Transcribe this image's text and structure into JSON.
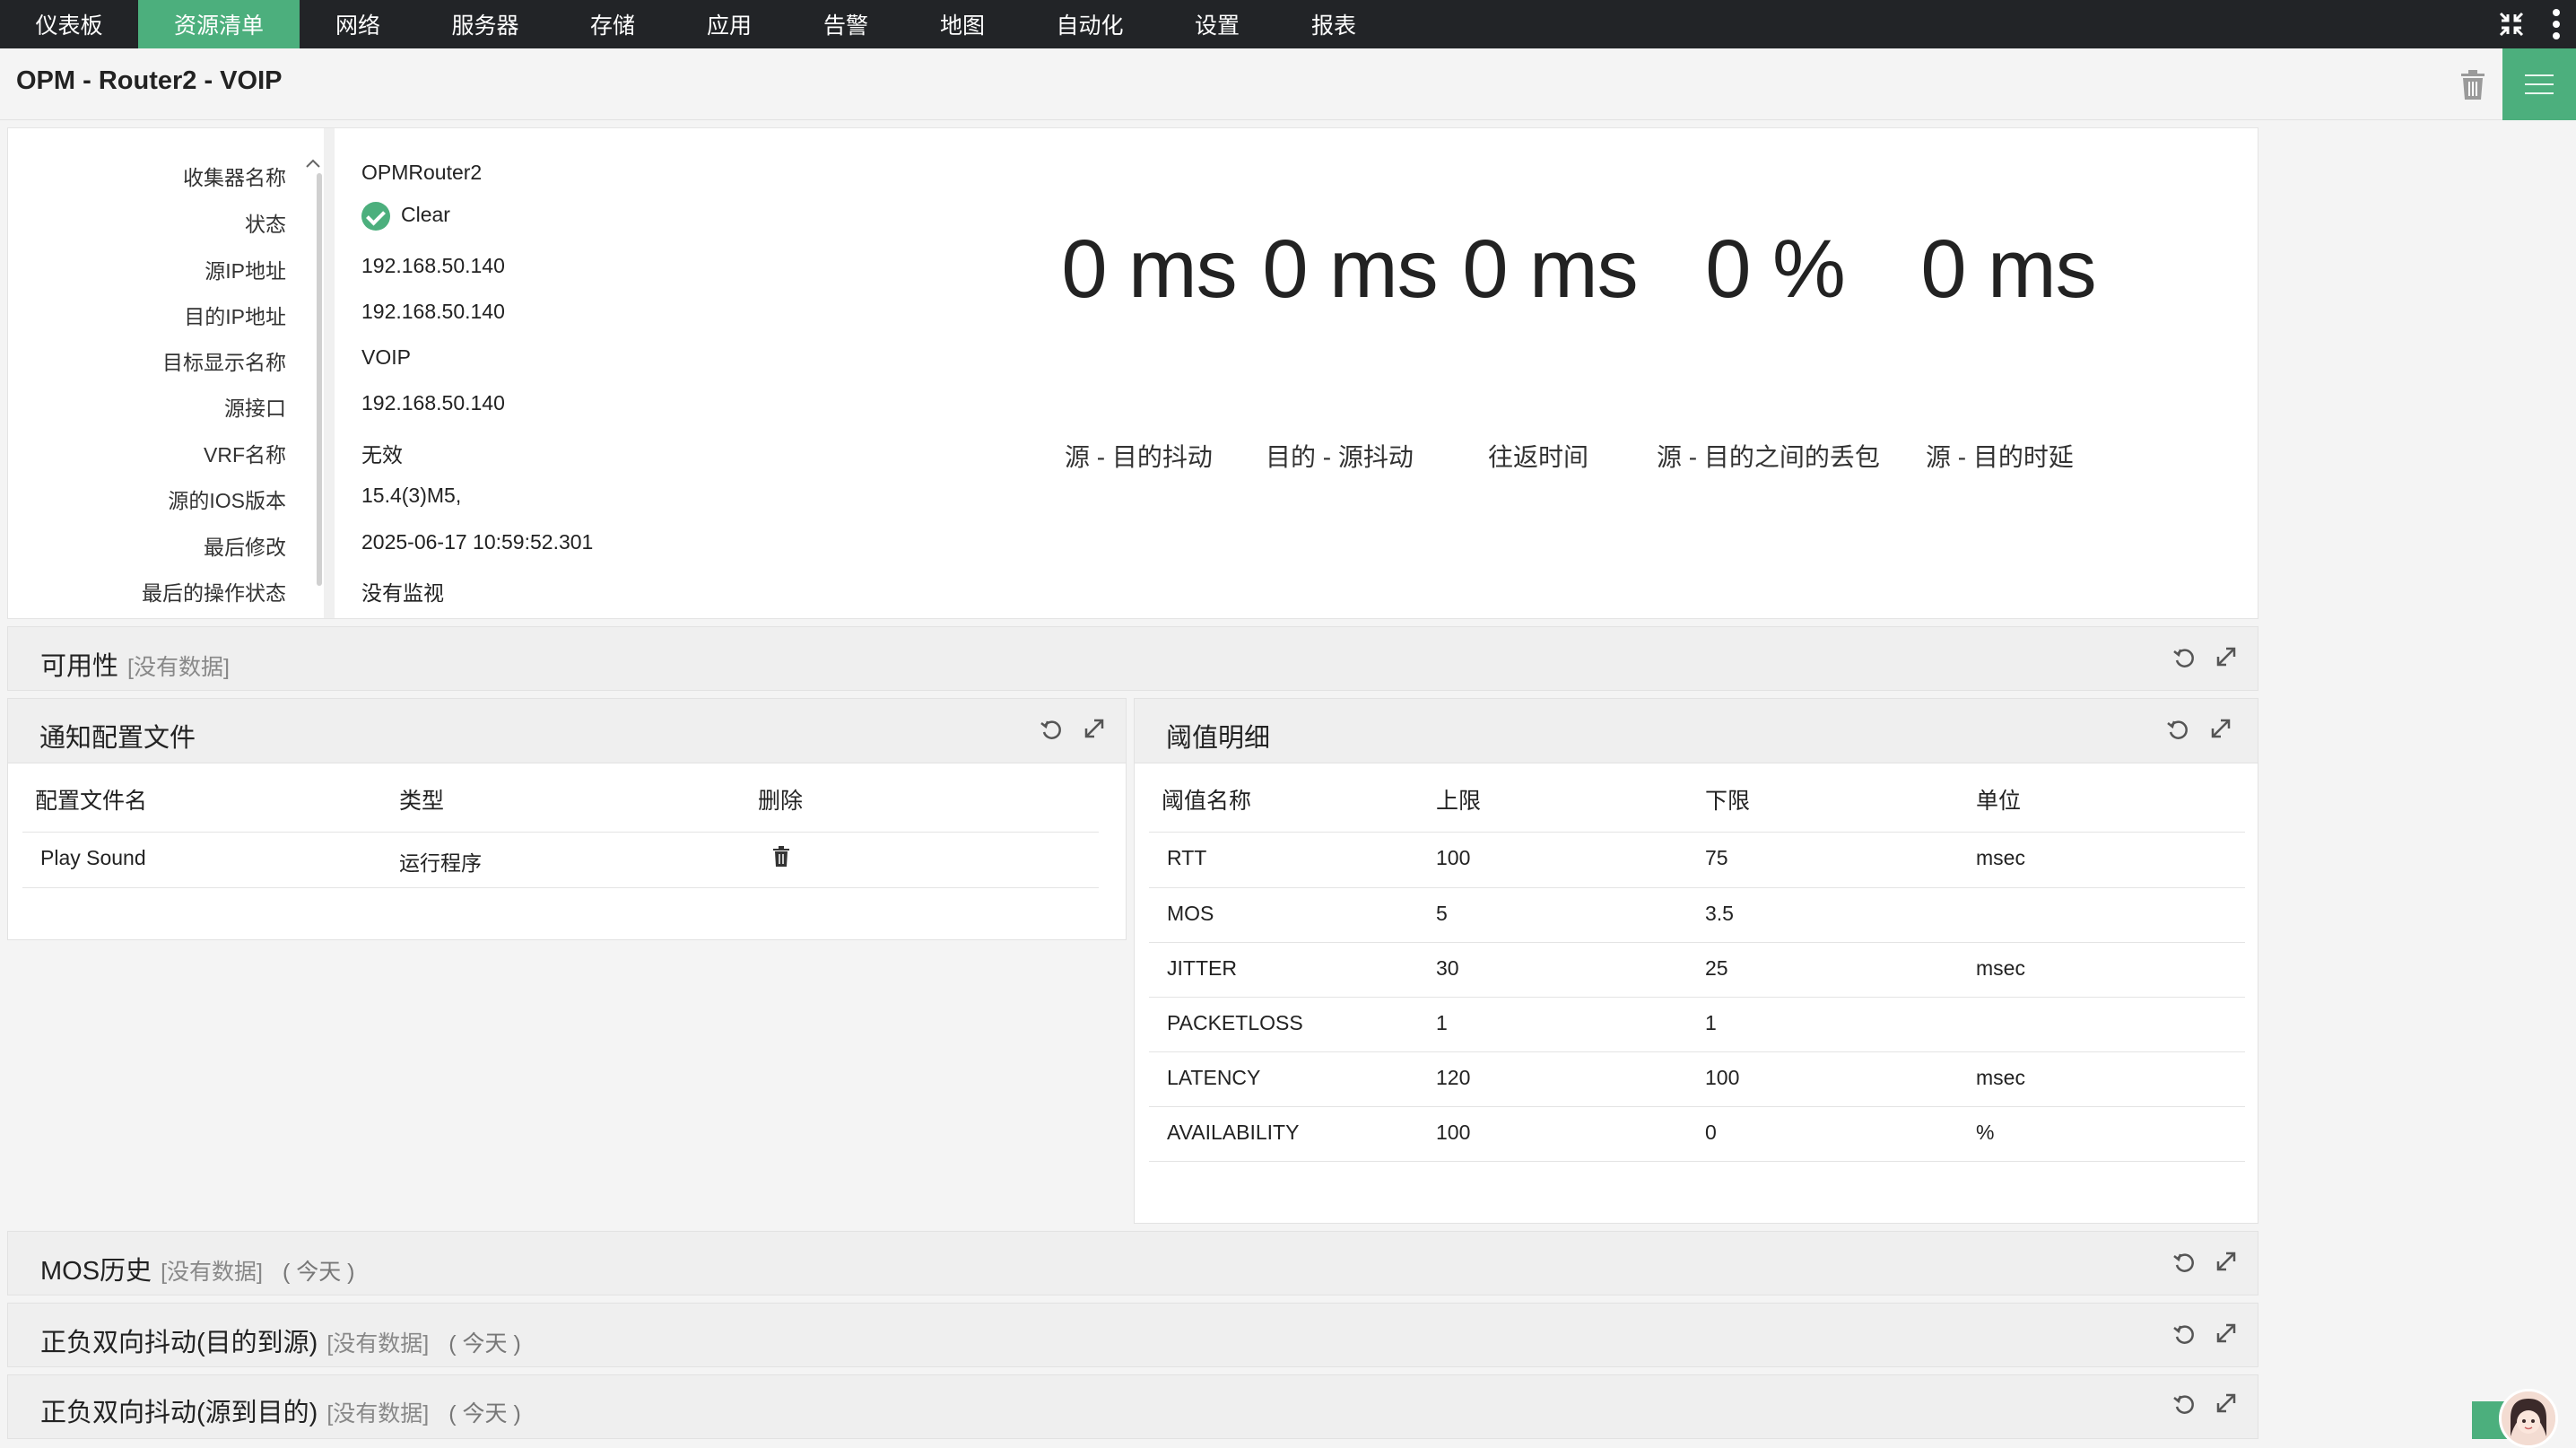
{
  "nav": {
    "items": [
      {
        "label": "仪表板"
      },
      {
        "label": "资源清单"
      },
      {
        "label": "网络"
      },
      {
        "label": "服务器"
      },
      {
        "label": "存储"
      },
      {
        "label": "应用"
      },
      {
        "label": "告警"
      },
      {
        "label": "地图"
      },
      {
        "label": "自动化"
      },
      {
        "label": "设置"
      },
      {
        "label": "报表"
      }
    ],
    "active": "资源清单",
    "right_icons": [
      "collapse-icon",
      "more-vertical-icon"
    ]
  },
  "page": {
    "title": "OPM - Router2 - VOIP"
  },
  "info": {
    "rows": [
      {
        "label": "收集器名称",
        "value": "OPMRouter2"
      },
      {
        "label": "状态",
        "value": "Clear"
      },
      {
        "label": "源IP地址",
        "value": "192.168.50.140"
      },
      {
        "label": "目的IP地址",
        "value": "192.168.50.140"
      },
      {
        "label": "目标显示名称",
        "value": "VOIP"
      },
      {
        "label": "源接口",
        "value": "192.168.50.140"
      },
      {
        "label": "VRF名称",
        "value": "无效"
      },
      {
        "label": "源的IOS版本",
        "value": "15.4(3)M5,"
      },
      {
        "label": "最后修改",
        "value": "2025-06-17 10:59:52.301"
      },
      {
        "label": "最后的操作状态",
        "value": "没有监视"
      }
    ],
    "status_color": "#4caf7d"
  },
  "metrics": [
    {
      "value": "0 ms",
      "label": "源 - 目的抖动"
    },
    {
      "value": "0 ms",
      "label": "目的 - 源抖动"
    },
    {
      "value": "0 ms",
      "label": "往返时间"
    },
    {
      "value": "0 %",
      "label": "源 - 目的之间的丢包"
    },
    {
      "value": "0 ms",
      "label": "源 - 目的时延"
    }
  ],
  "availability": {
    "title": "可用性",
    "no_data": "[没有数据]"
  },
  "notification": {
    "title": "通知配置文件",
    "headers": [
      "配置文件名",
      "类型",
      "删除"
    ],
    "rows": [
      {
        "name": "Play Sound",
        "type": "运行程序"
      }
    ]
  },
  "threshold": {
    "title": "阈值明细",
    "headers": [
      "阈值名称",
      "上限",
      "下限",
      "单位"
    ],
    "rows": [
      {
        "name": "RTT",
        "upper": "100",
        "lower": "75",
        "unit": "msec"
      },
      {
        "name": "MOS",
        "upper": "5",
        "lower": "3.5",
        "unit": ""
      },
      {
        "name": "JITTER",
        "upper": "30",
        "lower": "25",
        "unit": "msec"
      },
      {
        "name": "PACKETLOSS",
        "upper": "1",
        "lower": "1",
        "unit": ""
      },
      {
        "name": "LATENCY",
        "upper": "120",
        "lower": "100",
        "unit": "msec"
      },
      {
        "name": "AVAILABILITY",
        "upper": "100",
        "lower": "0",
        "unit": "%"
      }
    ]
  },
  "history_sections": [
    {
      "title": "MOS历史",
      "no_data": "[没有数据]",
      "period": "( 今天 )"
    },
    {
      "title": "正负双向抖动(目的到源)",
      "no_data": "[没有数据]",
      "period": "( 今天 )"
    },
    {
      "title": "正负双向抖动(源到目的)",
      "no_data": "[没有数据]",
      "period": "( 今天 )"
    }
  ],
  "colors": {
    "accent": "#4caf7d",
    "nav_bg": "#222427"
  }
}
